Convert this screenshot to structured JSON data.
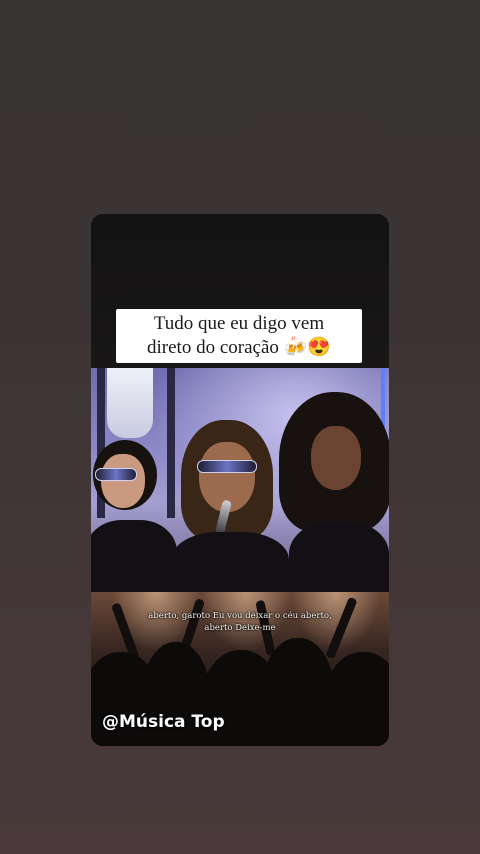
{
  "story": {
    "caption_line1": "Tudo que eu digo vem",
    "caption_line2": "direto do coração 🍻😍",
    "subtitle_line1": "aberto, garoto Eu vou deixar o céu aberto,",
    "subtitle_line2": "aberto Deixe-me",
    "watermark": "@Música Top"
  },
  "colors": {
    "page_background": "#3b3535",
    "caption_background": "#ffffff",
    "stage_light": "#8b87c6",
    "caption_text": "#1a1a1a"
  }
}
